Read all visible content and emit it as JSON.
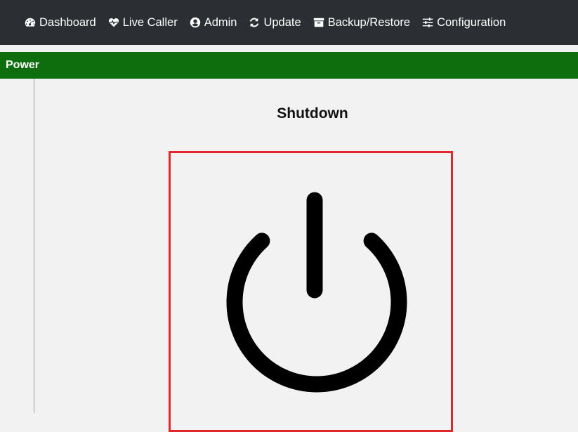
{
  "nav": {
    "items": [
      {
        "label": "Dashboard",
        "icon": "dashboard-icon"
      },
      {
        "label": "Live Caller",
        "icon": "heartbeat-icon"
      },
      {
        "label": "Admin",
        "icon": "user-circle-icon"
      },
      {
        "label": "Update",
        "icon": "refresh-icon"
      },
      {
        "label": "Backup/Restore",
        "icon": "archive-icon"
      },
      {
        "label": "Configuration",
        "icon": "sliders-icon"
      }
    ]
  },
  "panel": {
    "title": "Power",
    "action_title": "Shutdown",
    "action_icon": "power-icon"
  },
  "colors": {
    "navbar": "#2b2f33",
    "panel_header": "#0e6e0e",
    "button_border": "#e3262b",
    "background": "#f2f2f2"
  }
}
